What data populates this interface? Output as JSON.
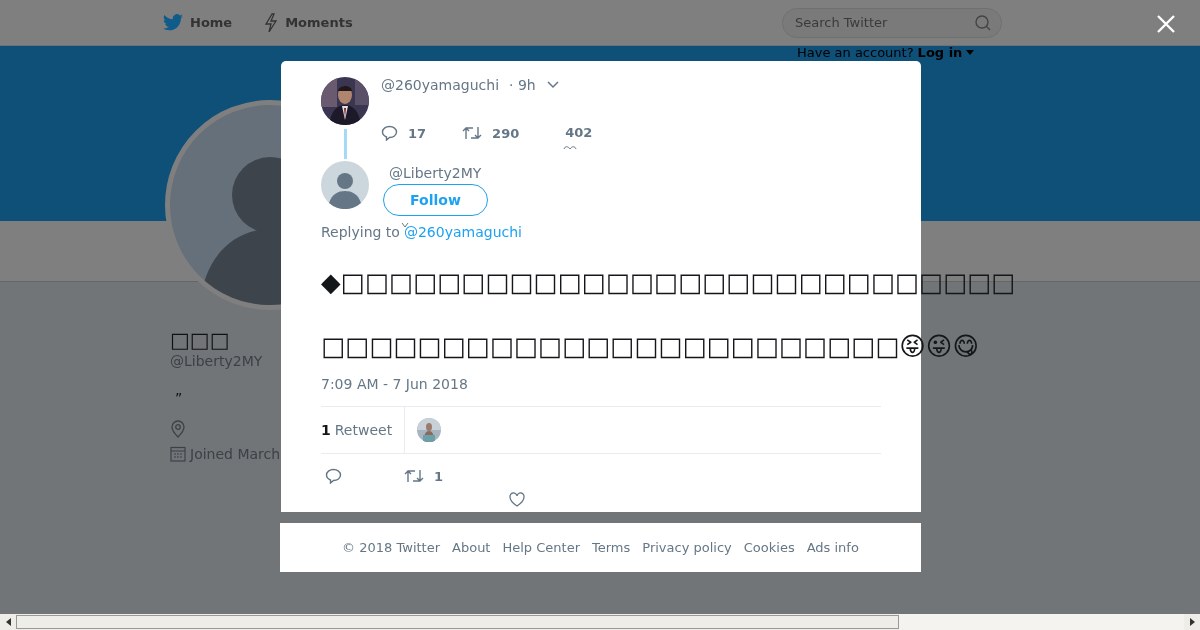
{
  "nav": {
    "items": [
      {
        "label": "Home"
      },
      {
        "label": "Moments"
      }
    ],
    "search": {
      "placeholder": "Search Twitter"
    },
    "account_prompt": "Have an account?",
    "login": "Log in"
  },
  "profile": {
    "name": "□□□",
    "handle": "@Liberty2MY",
    "bio": "”",
    "joined": "Joined March"
  },
  "parent_tweet": {
    "handle": "@260yamaguchi",
    "time": "· 9h",
    "replies": "17",
    "retweets": "290",
    "likes": "402"
  },
  "reply_tweet": {
    "handle": "@Liberty2MY",
    "follow": "Follow",
    "replying_label": "Replying to",
    "replying_to": "@260yamaguchi",
    "lines": [
      "◆□□□□□□□□□□□□□□□□□□□□□□□□□□□□",
      "□□□□□□□□□□□□□□□□□□□□□□□□😝😜😋"
    ],
    "timestamp": "7:09 AM - 7 Jun 2018",
    "retweet_count": "1",
    "retweet_label": "Retweet",
    "action_retweets": "1"
  },
  "footer": [
    "© 2018 Twitter",
    "About",
    "Help Center",
    "Terms",
    "Privacy policy",
    "Cookies",
    "Ads info"
  ]
}
